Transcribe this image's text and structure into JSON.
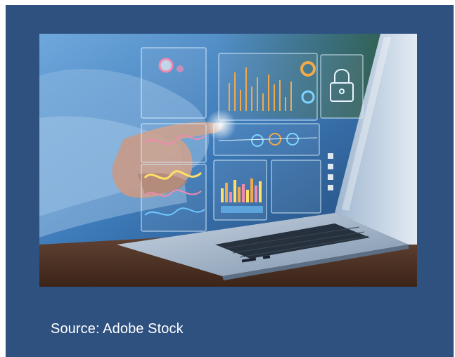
{
  "slide": {
    "background_color": "#2e5180",
    "image": {
      "description_icon": "laptop-hologram-dashboard-photo"
    },
    "caption": "Source: Adobe Stock"
  }
}
